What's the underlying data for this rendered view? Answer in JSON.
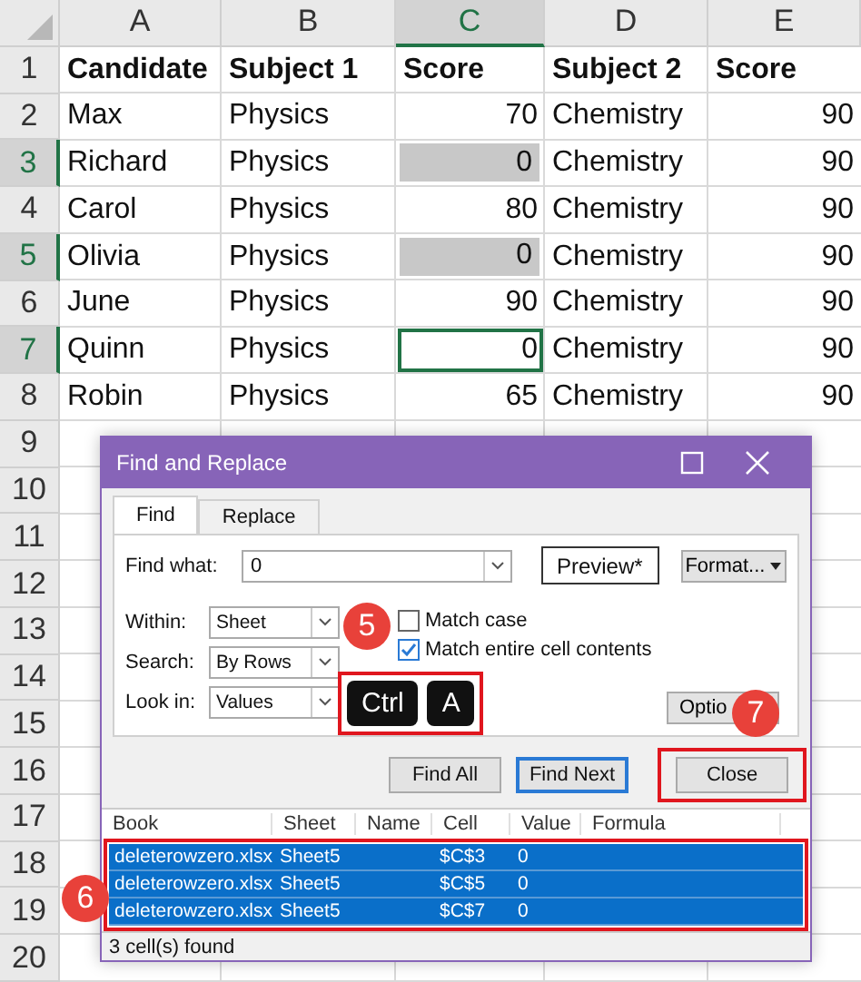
{
  "sheet": {
    "columns": [
      {
        "label": "A",
        "selected": false
      },
      {
        "label": "B",
        "selected": false
      },
      {
        "label": "C",
        "selected": true
      },
      {
        "label": "D",
        "selected": false
      },
      {
        "label": "E",
        "selected": false
      }
    ],
    "rows": [
      {
        "number": "1",
        "selected": false,
        "cells": [
          "Candidate",
          "Subject 1",
          "Score",
          "Subject 2",
          "Score"
        ]
      },
      {
        "number": "2",
        "selected": false,
        "cells": [
          "Max",
          "Physics",
          {
            "text": "70",
            "shaded": false,
            "active": false
          },
          "Chemistry",
          "90"
        ]
      },
      {
        "number": "3",
        "selected": true,
        "cells": [
          "Richard",
          "Physics",
          {
            "text": "0",
            "shaded": true,
            "active": false
          },
          "Chemistry",
          "90"
        ]
      },
      {
        "number": "4",
        "selected": false,
        "cells": [
          "Carol",
          "Physics",
          {
            "text": "80",
            "shaded": false,
            "active": false
          },
          "Chemistry",
          "90"
        ]
      },
      {
        "number": "5",
        "selected": true,
        "cells": [
          "Olivia",
          "Physics",
          {
            "text": "0",
            "shaded": true,
            "active": false
          },
          "Chemistry",
          "90"
        ]
      },
      {
        "number": "6",
        "selected": false,
        "cells": [
          "June",
          "Physics",
          {
            "text": "90",
            "shaded": false,
            "active": false
          },
          "Chemistry",
          "90"
        ]
      },
      {
        "number": "7",
        "selected": true,
        "cells": [
          "Quinn",
          "Physics",
          {
            "text": "0",
            "shaded": false,
            "active": true
          },
          "Chemistry",
          "90"
        ]
      },
      {
        "number": "8",
        "selected": false,
        "cells": [
          "Robin",
          "Physics",
          {
            "text": "65",
            "shaded": false,
            "active": false
          },
          "Chemistry",
          "90"
        ]
      },
      {
        "number": "9",
        "selected": false
      },
      {
        "number": "10",
        "selected": false
      },
      {
        "number": "11",
        "selected": false
      },
      {
        "number": "12",
        "selected": false
      },
      {
        "number": "13",
        "selected": false
      },
      {
        "number": "14",
        "selected": false
      },
      {
        "number": "15",
        "selected": false
      },
      {
        "number": "16",
        "selected": false
      },
      {
        "number": "17",
        "selected": false
      },
      {
        "number": "18",
        "selected": false
      },
      {
        "number": "19",
        "selected": false
      },
      {
        "number": "20",
        "selected": false
      }
    ]
  },
  "dialog": {
    "title": "Find and Replace",
    "tabs": [
      {
        "label": "Find",
        "selected": true
      },
      {
        "label": "Replace",
        "selected": false
      }
    ],
    "find_what": {
      "label": "Find what:",
      "value": "0"
    },
    "preview": "Preview*",
    "format_button": "Format...",
    "options": [
      {
        "label": "Within:",
        "value": "Sheet"
      },
      {
        "label": "Search:",
        "value": "By Rows"
      },
      {
        "label": "Look in:",
        "value": "Values"
      }
    ],
    "checkboxes": [
      {
        "label": "Match case",
        "checked": false
      },
      {
        "label": "Match entire cell contents",
        "checked": true
      }
    ],
    "options_button": "Optio",
    "buttons": [
      {
        "label": "Find All",
        "focused": false
      },
      {
        "label": "Find Next",
        "focused": true
      },
      {
        "label": "Close",
        "focused": false
      }
    ],
    "results": {
      "columns": [
        "Book",
        "Sheet",
        "Name",
        "Cell",
        "Value",
        "Formula"
      ],
      "rows": [
        {
          "selected": true,
          "cells": [
            "deleterowzero.xlsx",
            "Sheet5",
            "",
            "$C$3",
            "0",
            ""
          ]
        },
        {
          "selected": true,
          "cells": [
            "deleterowzero.xlsx",
            "Sheet5",
            "",
            "$C$5",
            "0",
            ""
          ]
        },
        {
          "selected": true,
          "cells": [
            "deleterowzero.xlsx",
            "Sheet5",
            "",
            "$C$7",
            "0",
            ""
          ]
        }
      ]
    },
    "status": "3 cell(s) found"
  },
  "annotations": {
    "keys": [
      "Ctrl",
      "A"
    ],
    "badges": [
      "5",
      "7",
      "6"
    ]
  }
}
